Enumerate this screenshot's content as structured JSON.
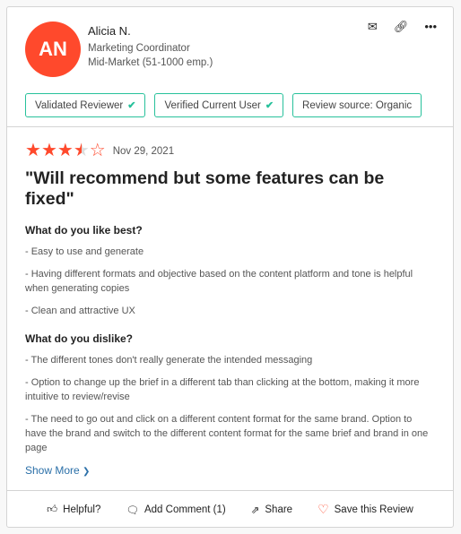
{
  "reviewer": {
    "initials": "AN",
    "name": "Alicia N.",
    "role": "Marketing Coordinator",
    "segment": "Mid-Market (51-1000 emp.)",
    "avatar_color": "#ff492c"
  },
  "header_icons": [
    "mail-icon",
    "link-icon",
    "more-icon"
  ],
  "badges": [
    {
      "label": "Validated Reviewer",
      "checked": true
    },
    {
      "label": "Verified Current User",
      "checked": true
    },
    {
      "label": "Review source: Organic",
      "checked": false
    }
  ],
  "review": {
    "rating": 3.5,
    "max_rating": 5,
    "date": "Nov 29, 2021",
    "title": "\"Will recommend but some features can be fixed\"",
    "likes_heading": "What do you like best?",
    "likes": [
      "- Easy to use and generate",
      "- Having different formats and objective based on the content platform and tone is helpful when generating copies",
      "- Clean and attractive UX"
    ],
    "dislikes_heading": "What do you dislike?",
    "dislikes": [
      "- The different tones don't really generate the intended messaging",
      "- Option to change up the brief in a different tab than clicking at the bottom, making it more intuitive to review/revise",
      "- The need to go out and click on a different content format for the same brand. Option to have the brand and switch to the different content format for the same brief and brand in one page"
    ],
    "show_more": "Show More"
  },
  "footer": {
    "helpful": "Helpful?",
    "comment": "Add Comment (1)",
    "share": "Share",
    "save": "Save this Review"
  }
}
